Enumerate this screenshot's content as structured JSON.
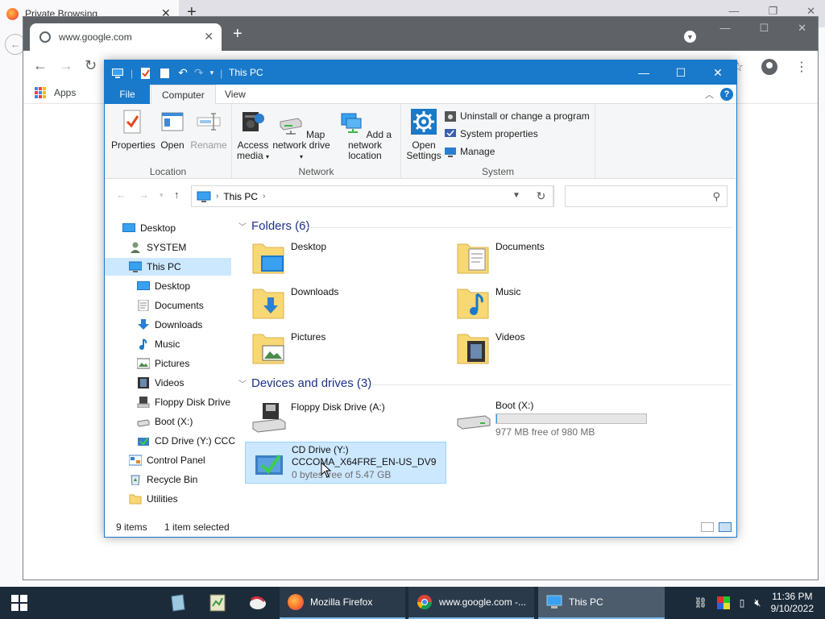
{
  "firefox": {
    "tab_title": "Private Browsing"
  },
  "chrome": {
    "tab_title": "www.google.com",
    "bookmarks_apps": "Apps"
  },
  "explorer": {
    "title": "This PC",
    "tabs": {
      "file": "File",
      "computer": "Computer",
      "view": "View"
    },
    "ribbon": {
      "location": {
        "label": "Location",
        "properties": "Properties",
        "open": "Open",
        "rename": "Rename"
      },
      "network": {
        "label": "Network",
        "access_media": "Access media",
        "map_network_drive": "Map network drive",
        "add_network_location": "Add a network location"
      },
      "system": {
        "label": "System",
        "open_settings": "Open Settings",
        "uninstall": "Uninstall or change a program",
        "system_properties": "System properties",
        "manage": "Manage"
      }
    },
    "address": {
      "path": "This PC",
      "search_placeholder": ""
    },
    "nav": {
      "desktop": "Desktop",
      "system": "SYSTEM",
      "this_pc": "This PC",
      "pc_desktop": "Desktop",
      "documents": "Documents",
      "downloads": "Downloads",
      "music": "Music",
      "pictures": "Pictures",
      "videos": "Videos",
      "floppy": "Floppy Disk Drive",
      "boot": "Boot (X:)",
      "cd": "CD Drive (Y:) CCC",
      "control_panel": "Control Panel",
      "recycle_bin": "Recycle Bin",
      "utilities": "Utilities"
    },
    "folders": {
      "header": "Folders (6)",
      "desktop": "Desktop",
      "documents": "Documents",
      "downloads": "Downloads",
      "music": "Music",
      "pictures": "Pictures",
      "videos": "Videos"
    },
    "drives": {
      "header": "Devices and drives (3)",
      "floppy": {
        "name": "Floppy Disk Drive (A:)"
      },
      "boot": {
        "name": "Boot (X:)",
        "free": "977 MB free of 980 MB",
        "used_fraction": 0.003
      },
      "cd": {
        "name": "CD Drive (Y:)",
        "label": "CCCOMA_X64FRE_EN-US_DV9",
        "free": "0 bytes free of 5.47 GB"
      }
    },
    "status": {
      "count": "9 items",
      "selected": "1 item selected"
    }
  },
  "taskbar": {
    "firefox": "Mozilla Firefox",
    "chrome": "www.google.com -...",
    "explorer": "This PC",
    "time": "11:36 PM",
    "date": "9/10/2022"
  },
  "colors": {
    "accent": "#1979ca",
    "selection": "#cce8ff",
    "taskbar": "#1c2b3a",
    "section_header": "#1e3287"
  }
}
